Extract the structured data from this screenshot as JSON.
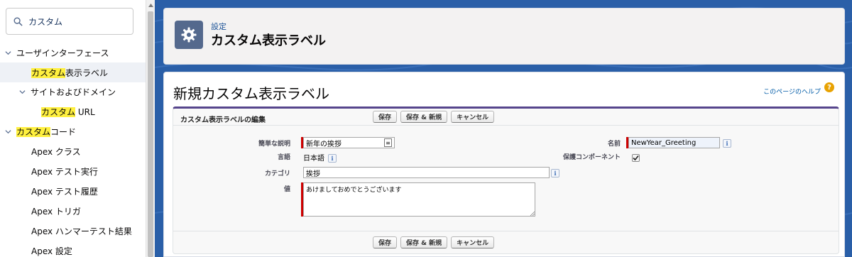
{
  "search": {
    "value": "カスタム",
    "placeholder": ""
  },
  "sidebar": {
    "items": [
      {
        "pre": "",
        "hl": "",
        "post": "ユーザインターフェース"
      },
      {
        "pre": "",
        "hl": "カスタム",
        "post": "表示ラベル"
      },
      {
        "pre": "",
        "hl": "",
        "post": "サイトおよびドメイン"
      },
      {
        "pre": "",
        "hl": "カスタム",
        "post": " URL"
      },
      {
        "pre": "",
        "hl": "カスタム",
        "post": "コード"
      },
      {
        "pre": "",
        "hl": "",
        "post": "Apex クラス"
      },
      {
        "pre": "",
        "hl": "",
        "post": "Apex テスト実行"
      },
      {
        "pre": "",
        "hl": "",
        "post": "Apex テスト履歴"
      },
      {
        "pre": "",
        "hl": "",
        "post": "Apex トリガ"
      },
      {
        "pre": "",
        "hl": "",
        "post": "Apex ハンマーテスト結果"
      },
      {
        "pre": "",
        "hl": "",
        "post": "Apex 設定"
      }
    ]
  },
  "header": {
    "small": "設定",
    "title": "カスタム表示ラベル"
  },
  "main": {
    "title": "新規カスタム表示ラベル",
    "help": "このページのヘルプ",
    "block_title": "カスタム表示ラベルの編集",
    "buttons": {
      "save": "保存",
      "save_new": "保存 & 新規",
      "cancel": "キャンセル"
    },
    "fields": {
      "short_desc_label": "簡単な説明",
      "short_desc_value": "新年の挨拶",
      "language_label": "言語",
      "language_value": "日本語",
      "category_label": "カテゴリ",
      "category_value": "挨拶",
      "value_label": "値",
      "value_value": "あけましておめでとうございます",
      "name_label": "名前",
      "name_value": "NewYear_Greeting",
      "protected_label": "保護コンポーネント",
      "protected_checked": true
    }
  },
  "colors": {
    "accent": "#56458c",
    "highlight": "#fff03f",
    "brand_bg": "#2a5fa8"
  }
}
